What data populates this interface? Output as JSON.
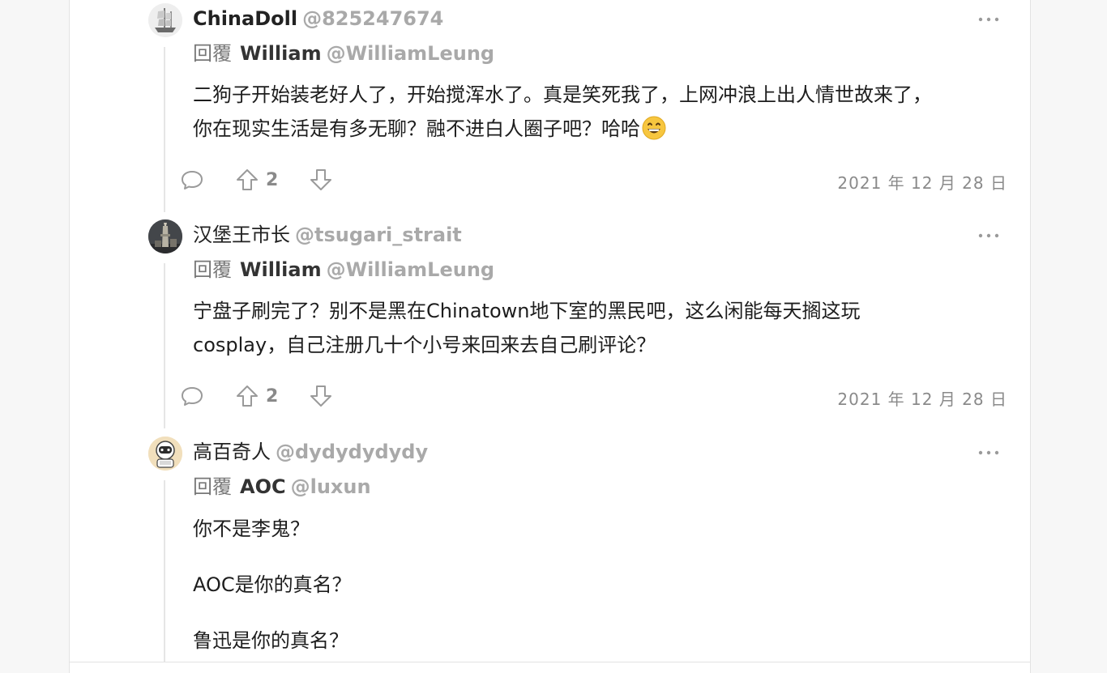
{
  "comments": [
    {
      "name": "ChinaDoll",
      "handle": "@825247674",
      "reply_label": "回覆",
      "reply_to_name": "William",
      "reply_to_handle": "@WilliamLeung",
      "lines": [
        "二狗子开始装老好人了，开始搅浑水了。真是笑死我了，上网冲浪上出人情世故来了，",
        "你在现实生活是有多无聊？融不进白人圈子吧？哈哈"
      ],
      "emoji": "grinning-face-emoji",
      "upvotes": "2",
      "date": "2021 年 12 月 28 日",
      "avatar": "ship-avatar"
    },
    {
      "name": "汉堡王市长",
      "handle": "@tsugari_strait",
      "reply_label": "回覆",
      "reply_to_name": "William",
      "reply_to_handle": "@WilliamLeung",
      "lines": [
        "宁盘子刷完了？别不是黑在Chinatown地下室的黑民吧，这么闲能每天搁这玩",
        "cosplay，自己注册几十个小号来回来去自己刷评论？"
      ],
      "upvotes": "2",
      "date": "2021 年 12 月 28 日",
      "avatar": "tower-avatar"
    },
    {
      "name": "高百奇人",
      "handle": "@dydydydydy",
      "reply_label": "回覆",
      "reply_to_name": "AOC",
      "reply_to_handle": "@luxun",
      "lines": [
        "你不是李鬼？",
        "AOC是你的真名？",
        "鲁迅是你的真名？"
      ],
      "avatar": "astronaut-avatar"
    }
  ],
  "colors": {
    "background": "#f7f7f7",
    "panel": "#ffffff",
    "muted": "#a9a9a9",
    "text": "#1d1d1d",
    "icon": "#9a9a9a"
  }
}
